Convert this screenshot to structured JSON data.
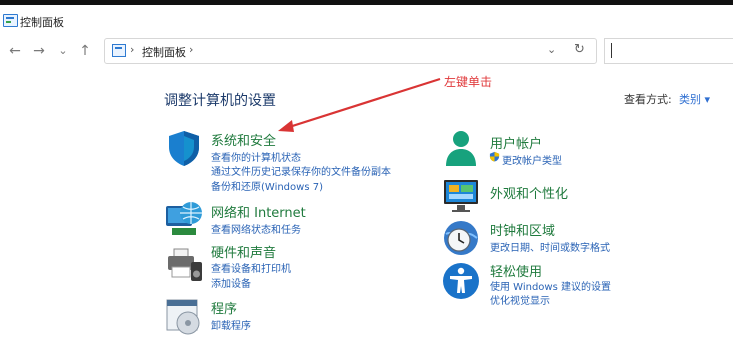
{
  "window": {
    "title": "控制面板"
  },
  "nav": {
    "back": "←",
    "forward": "→",
    "recent": "⌄",
    "up": "↑"
  },
  "address": {
    "sep1": "›",
    "crumb": "控制面板",
    "sep2": "›",
    "dropdown": "⌄",
    "refresh": "↻"
  },
  "search": {
    "value": ""
  },
  "main": {
    "heading": "调整计算机的设置",
    "view_by_label": "查看方式:",
    "view_by_value": "类别 ▾"
  },
  "annotation": {
    "text": "左键单击",
    "color": "#e0393b"
  },
  "categories_left": [
    {
      "title": "系统和安全",
      "links": [
        "查看你的计算机状态",
        "通过文件历史记录保存你的文件备份副本",
        "备份和还原(Windows 7)"
      ]
    },
    {
      "title": "网络和 Internet",
      "links": [
        "查看网络状态和任务"
      ]
    },
    {
      "title": "硬件和声音",
      "links": [
        "查看设备和打印机",
        "添加设备"
      ]
    },
    {
      "title": "程序",
      "links": [
        "卸载程序"
      ]
    }
  ],
  "categories_right": [
    {
      "title": "用户帐户",
      "links": [
        "更改帐户类型"
      ]
    },
    {
      "title": "外观和个性化",
      "links": []
    },
    {
      "title": "时钟和区域",
      "links": [
        "更改日期、时间或数字格式"
      ]
    },
    {
      "title": "轻松使用",
      "links": [
        "使用 Windows 建议的设置",
        "优化视觉显示"
      ]
    }
  ],
  "colors": {
    "category_title": "#1f7a3d",
    "link": "#2a63b5",
    "heading": "#1d3b6b"
  }
}
